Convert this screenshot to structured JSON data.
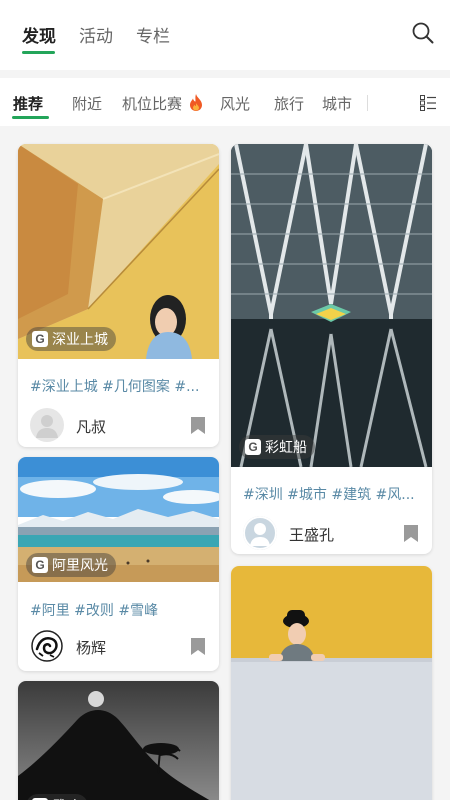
{
  "top_tabs": [
    {
      "label": "发现",
      "active": true
    },
    {
      "label": "活动",
      "active": false
    },
    {
      "label": "专栏",
      "active": false
    }
  ],
  "categories": [
    {
      "label": "推荐",
      "active": true
    },
    {
      "label": "附近",
      "active": false
    },
    {
      "label": "机位比赛",
      "active": false,
      "icon": "fire-icon"
    },
    {
      "label": "风光",
      "active": false
    },
    {
      "label": "旅行",
      "active": false
    },
    {
      "label": "城市",
      "active": false
    }
  ],
  "accent_color": "#23a55a",
  "cards": [
    {
      "location": "深业上城",
      "tags": "#深业上城 #几何图案 #...",
      "author": "凡叔"
    },
    {
      "location": "彩虹船",
      "tags": "#深圳 #城市 #建筑 #风...",
      "author": "王盛孔"
    },
    {
      "location": "阿里风光",
      "tags": "#阿里 #改则 #雪峰",
      "author": "杨辉"
    },
    {
      "location": "",
      "tags": "",
      "author": ""
    },
    {
      "location": "武功",
      "tags": "",
      "author": ""
    }
  ]
}
